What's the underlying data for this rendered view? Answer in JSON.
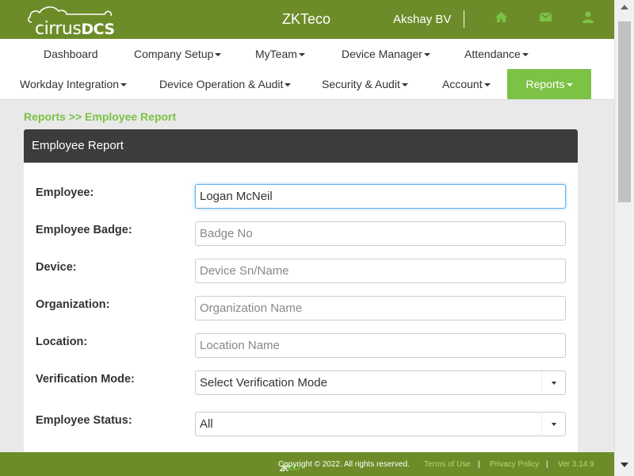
{
  "header": {
    "logo_text": "cirrus",
    "logo_bold": "DCS",
    "brand": "ZKTeco",
    "username": "Akshay BV",
    "icons": [
      "home-icon",
      "envelope-icon",
      "user-icon"
    ]
  },
  "nav": {
    "row1": [
      {
        "label": "Dashboard",
        "caret": false
      },
      {
        "label": "Company Setup",
        "caret": true
      },
      {
        "label": "MyTeam",
        "caret": true
      },
      {
        "label": "Device Manager",
        "caret": true
      },
      {
        "label": "Attendance",
        "caret": true
      }
    ],
    "row2": [
      {
        "label": "Workday Integration",
        "caret": true
      },
      {
        "label": "Device Operation & Audit",
        "caret": true
      },
      {
        "label": "Security & Audit",
        "caret": true
      },
      {
        "label": "Account",
        "caret": true
      },
      {
        "label": "Reports",
        "caret": true,
        "active": true
      }
    ]
  },
  "breadcrumb": "Reports >> Employee Report",
  "panel": {
    "title": "Employee Report",
    "fields": {
      "employee": {
        "label": "Employee:",
        "value": "Logan McNeil",
        "placeholder": ""
      },
      "badge": {
        "label": "Employee Badge:",
        "value": "",
        "placeholder": "Badge No"
      },
      "device": {
        "label": "Device:",
        "value": "",
        "placeholder": "Device Sn/Name"
      },
      "organization": {
        "label": "Organization:",
        "value": "",
        "placeholder": "Organization Name"
      },
      "location": {
        "label": "Location:",
        "value": "",
        "placeholder": "Location Name"
      },
      "verification": {
        "label": "Verification Mode:",
        "selected": "Select Verification Mode"
      },
      "status": {
        "label": "Employee Status:",
        "selected": "All"
      }
    }
  },
  "footer": {
    "copyright": "Copyright © 2022. All rights reserved.",
    "terms": "Terms of Use",
    "privacy": "Privacy Policy",
    "version": "Ver 3.14.9",
    "zk_logo": "ZK",
    "zk_logo_sub": "Teco"
  },
  "colors": {
    "topbar": "#6c8c29",
    "accent": "#7cc245",
    "panel_header": "#3a3c3d"
  }
}
